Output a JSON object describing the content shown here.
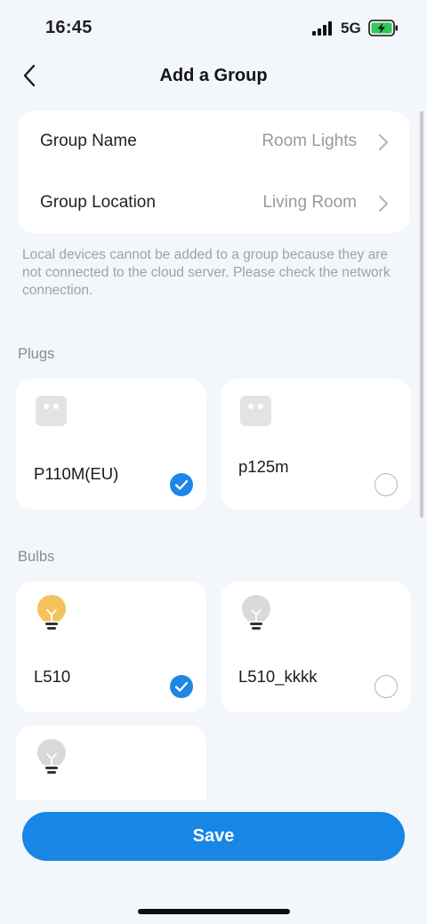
{
  "status_bar": {
    "time": "16:45",
    "network": "5G"
  },
  "header": {
    "title": "Add a Group"
  },
  "settings": [
    {
      "label": "Group Name",
      "value": "Room Lights"
    },
    {
      "label": "Group Location",
      "value": "Living Room"
    }
  ],
  "notice": "Local devices cannot be added to a group because they are not connected to the cloud server. Please check the network connection.",
  "sections": {
    "plugs": {
      "title": "Plugs",
      "devices": [
        {
          "name": "P110M(EU)",
          "selected": true,
          "icon": "smart-plug-icon"
        },
        {
          "name": "p125m",
          "selected": false,
          "icon": "smart-plug-icon"
        }
      ]
    },
    "bulbs": {
      "title": "Bulbs",
      "devices": [
        {
          "name": "L510",
          "selected": true,
          "icon": "lit-bulb-icon"
        },
        {
          "name": "L510_kkkk",
          "selected": false,
          "icon": "bulb-icon"
        },
        {
          "name": "",
          "selected": false,
          "icon": "bulb-icon"
        }
      ]
    }
  },
  "save_label": "Save",
  "colors": {
    "accent": "#1786e5",
    "background": "#f3f6fa",
    "bulb_on": "#f5c35c",
    "bulb_off": "#d9d9d9"
  }
}
